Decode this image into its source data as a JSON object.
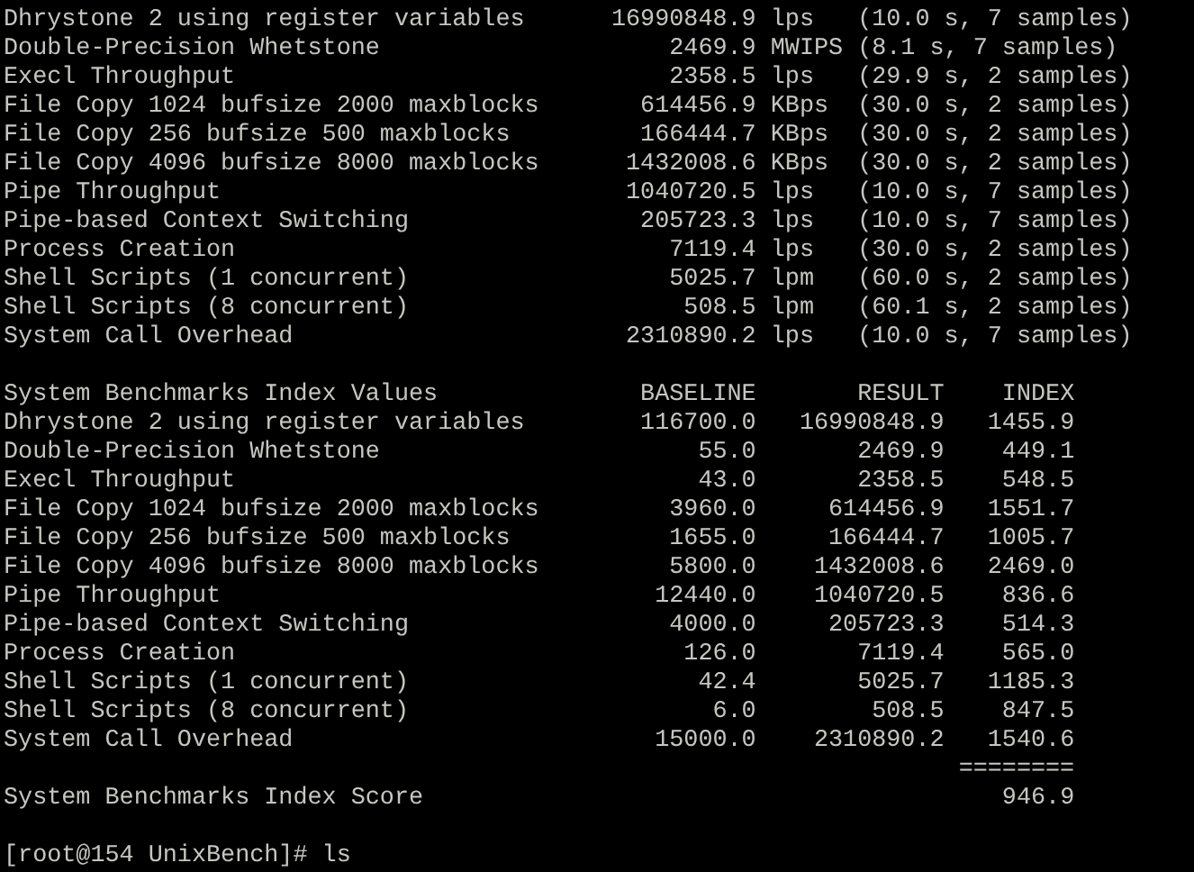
{
  "results": [
    {
      "name": "Dhrystone 2 using register variables",
      "value": "16990848.9",
      "unit": "lps",
      "detail": "(10.0 s, 7 samples)"
    },
    {
      "name": "Double-Precision Whetstone",
      "value": "2469.9",
      "unit": "MWIPS",
      "detail": "(8.1 s, 7 samples)"
    },
    {
      "name": "Execl Throughput",
      "value": "2358.5",
      "unit": "lps",
      "detail": "(29.9 s, 2 samples)"
    },
    {
      "name": "File Copy 1024 bufsize 2000 maxblocks",
      "value": "614456.9",
      "unit": "KBps",
      "detail": "(30.0 s, 2 samples)"
    },
    {
      "name": "File Copy 256 bufsize 500 maxblocks",
      "value": "166444.7",
      "unit": "KBps",
      "detail": "(30.0 s, 2 samples)"
    },
    {
      "name": "File Copy 4096 bufsize 8000 maxblocks",
      "value": "1432008.6",
      "unit": "KBps",
      "detail": "(30.0 s, 2 samples)"
    },
    {
      "name": "Pipe Throughput",
      "value": "1040720.5",
      "unit": "lps",
      "detail": "(10.0 s, 7 samples)"
    },
    {
      "name": "Pipe-based Context Switching",
      "value": "205723.3",
      "unit": "lps",
      "detail": "(10.0 s, 7 samples)"
    },
    {
      "name": "Process Creation",
      "value": "7119.4",
      "unit": "lps",
      "detail": "(30.0 s, 2 samples)"
    },
    {
      "name": "Shell Scripts (1 concurrent)",
      "value": "5025.7",
      "unit": "lpm",
      "detail": "(60.0 s, 2 samples)"
    },
    {
      "name": "Shell Scripts (8 concurrent)",
      "value": "508.5",
      "unit": "lpm",
      "detail": "(60.1 s, 2 samples)"
    },
    {
      "name": "System Call Overhead",
      "value": "2310890.2",
      "unit": "lps",
      "detail": "(10.0 s, 7 samples)"
    }
  ],
  "index": {
    "title": "System Benchmarks Index Values",
    "columns": [
      "BASELINE",
      "RESULT",
      "INDEX"
    ],
    "rows": [
      {
        "name": "Dhrystone 2 using register variables",
        "baseline": "116700.0",
        "result": "16990848.9",
        "index": "1455.9"
      },
      {
        "name": "Double-Precision Whetstone",
        "baseline": "55.0",
        "result": "2469.9",
        "index": "449.1"
      },
      {
        "name": "Execl Throughput",
        "baseline": "43.0",
        "result": "2358.5",
        "index": "548.5"
      },
      {
        "name": "File Copy 1024 bufsize 2000 maxblocks",
        "baseline": "3960.0",
        "result": "614456.9",
        "index": "1551.7"
      },
      {
        "name": "File Copy 256 bufsize 500 maxblocks",
        "baseline": "1655.0",
        "result": "166444.7",
        "index": "1005.7"
      },
      {
        "name": "File Copy 4096 bufsize 8000 maxblocks",
        "baseline": "5800.0",
        "result": "1432008.6",
        "index": "2469.0"
      },
      {
        "name": "Pipe Throughput",
        "baseline": "12440.0",
        "result": "1040720.5",
        "index": "836.6"
      },
      {
        "name": "Pipe-based Context Switching",
        "baseline": "4000.0",
        "result": "205723.3",
        "index": "514.3"
      },
      {
        "name": "Process Creation",
        "baseline": "126.0",
        "result": "7119.4",
        "index": "565.0"
      },
      {
        "name": "Shell Scripts (1 concurrent)",
        "baseline": "42.4",
        "result": "5025.7",
        "index": "1185.3"
      },
      {
        "name": "Shell Scripts (8 concurrent)",
        "baseline": "6.0",
        "result": "508.5",
        "index": "847.5"
      },
      {
        "name": "System Call Overhead",
        "baseline": "15000.0",
        "result": "2310890.2",
        "index": "1540.6"
      }
    ],
    "rule": "========",
    "score": {
      "label": "System Benchmarks Index Score",
      "value": "946.9"
    }
  },
  "prompt": "[root@154 UnixBench]# ls"
}
